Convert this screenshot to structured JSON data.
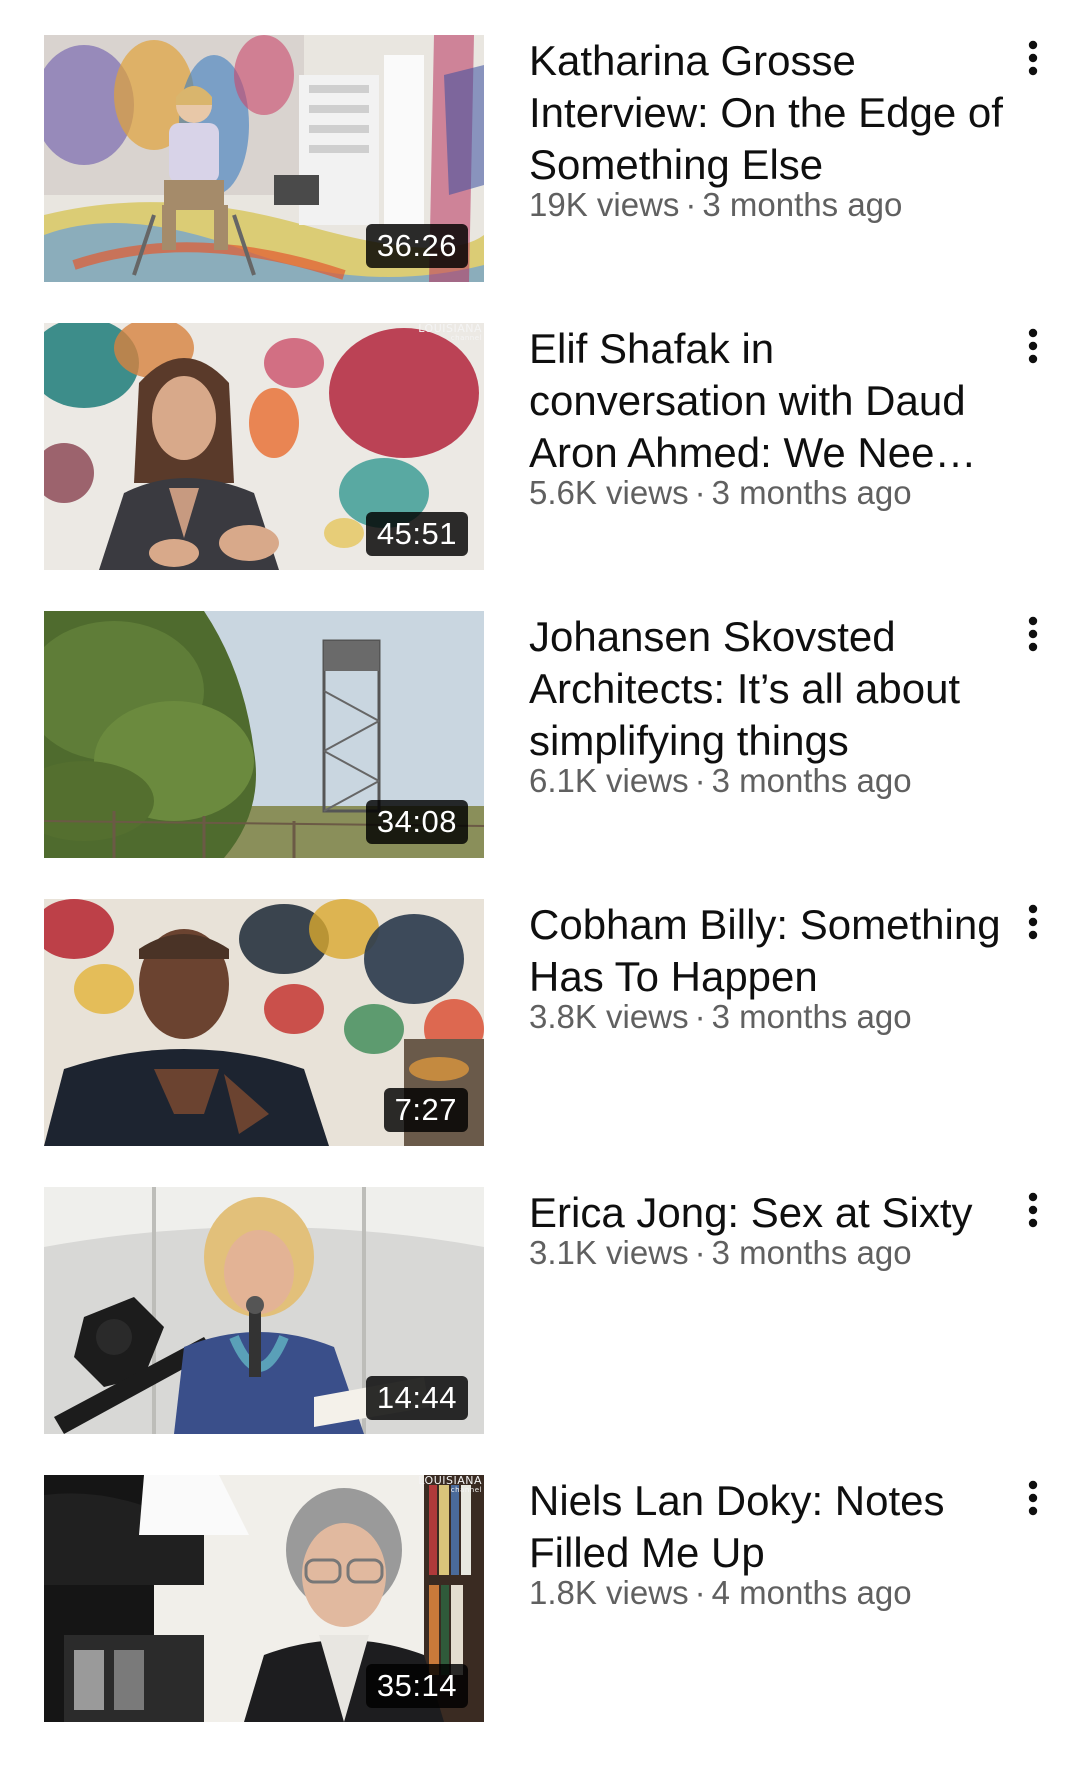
{
  "videos": [
    {
      "title": "Katharina Grosse Interview: On the Edge of Something Else",
      "views": "19K views",
      "age": "3 months ago",
      "duration": "36:26",
      "thumbnail": "studio-paint-spray-woman-icon",
      "channel_mark": ""
    },
    {
      "title": "Elif Shafak in conversation with Daud Aron Ahmed: We Nee…",
      "views": "5.6K views",
      "age": "3 months ago",
      "duration": "45:51",
      "thumbnail": "woman-speaking-abstract-painting-icon",
      "channel_mark": "LOUISIANA"
    },
    {
      "title": "Johansen Skovsted Architects: It’s all about simplifying things",
      "views": "6.1K views",
      "age": "3 months ago",
      "duration": "34:08",
      "thumbnail": "observation-tower-landscape-icon",
      "channel_mark": ""
    },
    {
      "title": "Cobham Billy: Something Has To Happen",
      "views": "3.8K views",
      "age": "3 months ago",
      "duration": "7:27",
      "thumbnail": "man-gesturing-abstract-painting-icon",
      "channel_mark": ""
    },
    {
      "title": "Erica Jong: Sex at Sixty",
      "views": "3.1K views",
      "age": "3 months ago",
      "duration": "14:44",
      "thumbnail": "woman-microphone-tent-icon",
      "channel_mark": ""
    },
    {
      "title": "Niels Lan Doky: Notes Filled Me Up",
      "views": "1.8K views",
      "age": "4 months ago",
      "duration": "35:14",
      "thumbnail": "man-glasses-bookshelf-icon",
      "channel_mark": "LOUISIANA"
    }
  ],
  "separator": "·",
  "menu_icon": "more-vertical-icon",
  "colors": {
    "title": "#0f0f0f",
    "meta": "#606060",
    "duration_bg": "#000000",
    "duration_text": "#ffffff"
  }
}
